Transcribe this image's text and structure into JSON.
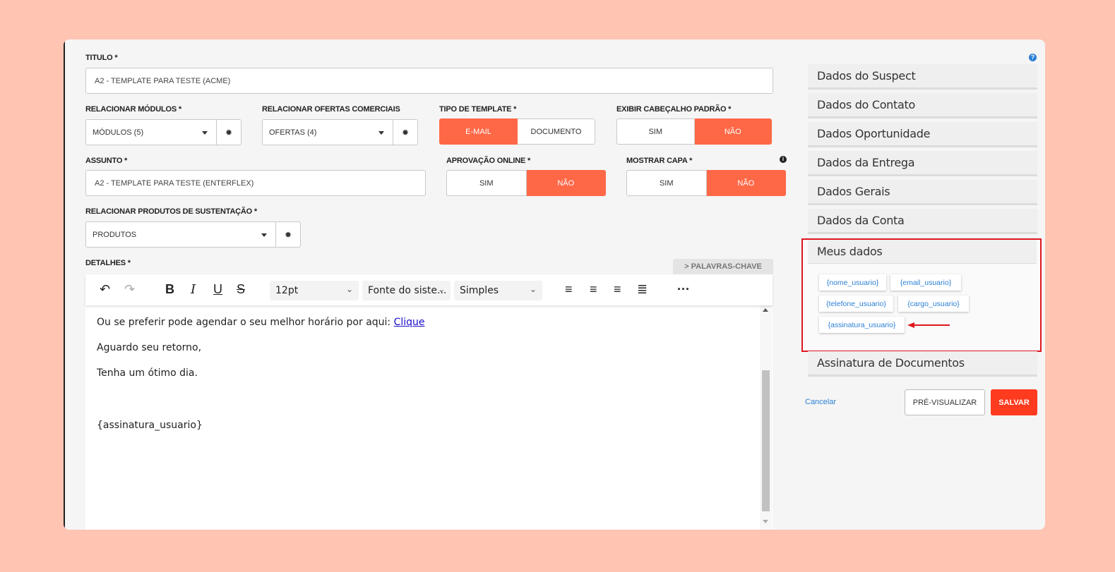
{
  "form": {
    "titulo_label": "TITULO *",
    "titulo_value": "A2 - TEMPLATE PARA TESTE (ACME)",
    "modulos_label": "RELACIONAR MÓDULOS *",
    "modulos_value": "MÓDULOS (5)",
    "ofertas_label": "RELACIONAR OFERTAS COMERCIAIS",
    "ofertas_value": "OFERTAS (4)",
    "tipo_label": "TIPO DE TEMPLATE *",
    "tipo_options": [
      "E-MAIL",
      "DOCUMENTO"
    ],
    "cabecalho_label": "EXIBIR CABEÇALHO PADRÃO *",
    "cabecalho_options": [
      "SIM",
      "NÃO"
    ],
    "assunto_label": "ASSUNTO *",
    "assunto_value": "A2 - TEMPLATE PARA TESTE (ENTERFLEX)",
    "aprovacao_label": "APROVAÇÃO ONLINE *",
    "aprovacao_options": [
      "SIM",
      "NÃO"
    ],
    "capa_label": "MOSTRAR CAPA *",
    "capa_options": [
      "SIM",
      "NÃO"
    ],
    "produtos_label": "RELACIONAR PRODUTOS DE SUSTENTAÇÃO *",
    "produtos_value": "PRODUTOS",
    "detalhes_label": "DETALHES *",
    "palavras_chave": "> PALAVRAS-CHAVE"
  },
  "editor": {
    "font_size": "12pt",
    "font_family": "Fonte do siste...",
    "block_format": "Simples",
    "line1_prefix": "Ou se preferir pode agendar o seu melhor horário por aqui: ",
    "line1_link": "Clique",
    "line2": "Aguardo seu retorno,",
    "line3": "Tenha um ótimo dia.",
    "line4": "{assinatura_usuario}"
  },
  "sidebar": {
    "items": [
      "Dados do Suspect",
      "Dados do Contato",
      "Dados Oportunidade",
      "Dados da Entrega",
      "Dados Gerais",
      "Dados da Conta"
    ],
    "meus_dados": {
      "title": "Meus dados",
      "chips": [
        "{nome_usuario}",
        "{email_usuario}",
        "{telefone_usuario}",
        "{cargo_usuario}",
        "{assinatura_usuario}"
      ]
    },
    "assinatura": "Assinatura de Documentos"
  },
  "actions": {
    "cancel": "Cancelar",
    "preview": "PRÉ-VISUALIZAR",
    "save": "SALVAR"
  },
  "colors": {
    "accent": "#ff6847",
    "save": "#ff3b1f",
    "highlight_border": "#e0161f",
    "link": "#2a7fd4"
  }
}
